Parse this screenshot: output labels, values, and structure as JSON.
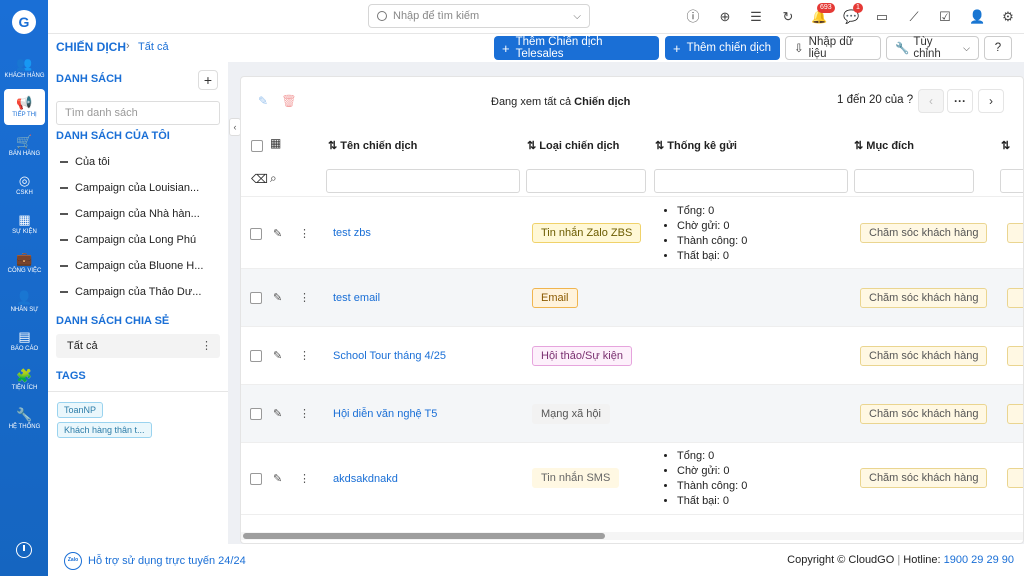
{
  "brand": {
    "accent": "#1a6fd6"
  },
  "sidebar": {
    "items": [
      {
        "label": "KHÁCH HÀNG",
        "icon": "customers-icon",
        "glyph": "👥"
      },
      {
        "label": "TIẾP THỊ",
        "icon": "megaphone-icon",
        "glyph": "📢"
      },
      {
        "label": "BÁN HÀNG",
        "icon": "cart-icon",
        "glyph": "🛒"
      },
      {
        "label": "CSKH",
        "icon": "lifebuoy-icon",
        "glyph": "◎"
      },
      {
        "label": "SỰ KIỆN",
        "icon": "calendar-icon",
        "glyph": "▦"
      },
      {
        "label": "CÔNG VIỆC",
        "icon": "briefcase-icon",
        "glyph": "💼"
      },
      {
        "label": "NHÂN SỰ",
        "icon": "person-icon",
        "glyph": "👤"
      },
      {
        "label": "BÁO CÁO",
        "icon": "report-icon",
        "glyph": "▤"
      },
      {
        "label": "TIỆN ÍCH",
        "icon": "utilities-icon",
        "glyph": "🧩"
      },
      {
        "label": "HỆ THỐNG",
        "icon": "wrench-icon",
        "glyph": "🔧"
      }
    ]
  },
  "topbar": {
    "search_placeholder": "Nhập để tìm kiếm",
    "notifications_count": "693",
    "messages_count": "1"
  },
  "header": {
    "title": "CHIẾN DỊCH",
    "breadcrumb_current": "Tất cả",
    "add_telesales_label": "Thêm Chiến dịch Telesales",
    "add_campaign_label": "Thêm chiến dịch",
    "import_label": "Nhập dữ liệu",
    "customize_label": "Tùy chỉnh"
  },
  "left_panel": {
    "lists_title": "DANH SÁCH",
    "search_placeholder": "Tìm danh sách",
    "my_lists_title": "DANH SÁCH CỦA TÔI",
    "my_lists": [
      "Của tôi",
      "Campaign của Louisian...",
      "Campaign của Nhà hàn...",
      "Campaign của Long Phú",
      "Campaign của Bluone H...",
      "Campaign của Thảo Dư..."
    ],
    "shared_title": "DANH SÁCH CHIA SẺ",
    "shared_item": "Tất cả",
    "tags_title": "TAGS",
    "tags": [
      "ToanNP",
      "Khách hàng thân t..."
    ]
  },
  "table": {
    "viewing_prefix": "Đang xem tất cả",
    "viewing_entity": "Chiến dịch",
    "pagination": "1 đến 20 của",
    "columns": [
      "Tên chiến dịch",
      "Loại chiến dịch",
      "Thống kê gửi",
      "Mục đích"
    ],
    "rows": [
      {
        "name": "test zbs",
        "type": "Tin nhắn Zalo ZBS",
        "stats": [
          "Tổng: 0",
          "Chờ gửi: 0",
          "Thành công: 0",
          "Thất bại: 0"
        ],
        "purpose": "Chăm sóc khách hàng"
      },
      {
        "name": "test email",
        "type": "Email",
        "stats": [],
        "purpose": "Chăm sóc khách hàng"
      },
      {
        "name": "School Tour tháng 4/25",
        "type": "Hội thảo/Sự kiện",
        "stats": [],
        "purpose": "Chăm sóc khách hàng"
      },
      {
        "name": "Hội diễn văn nghệ T5",
        "type": "Mạng xã hội",
        "stats": [],
        "purpose": "Chăm sóc khách hàng"
      },
      {
        "name": "akdsakdnakd",
        "type": "Tin nhắn SMS",
        "stats": [
          "Tổng: 0",
          "Chờ gửi: 0",
          "Thành công: 0",
          "Thất bại: 0"
        ],
        "purpose": "Chăm sóc khách hàng"
      }
    ]
  },
  "footer": {
    "zalo_label": "Zalo",
    "support_text": "Hỗ trợ sử dụng trực tuyến 24/24",
    "copyright": "Copyright © CloudGO",
    "hotline_label": "Hotline:",
    "hotline_number": "1900 29 29 90"
  }
}
